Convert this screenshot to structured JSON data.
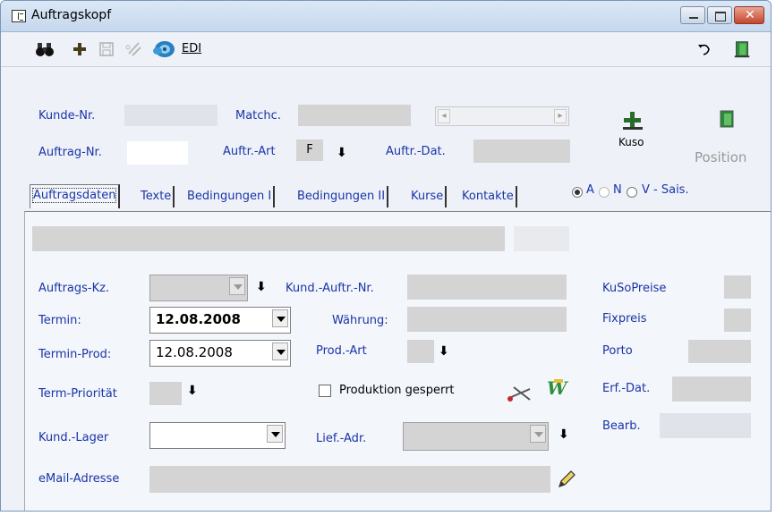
{
  "window": {
    "title": "Auftragskopf",
    "icons": [
      "window-icon",
      "minimize-icon",
      "maximize-icon",
      "close-icon"
    ]
  },
  "toolbar": {
    "edi_label": "EDI",
    "icons": [
      "binoculars-icon",
      "plus-icon",
      "save-icon",
      "cut-icon",
      "disc-icon",
      "undo-icon",
      "exit-door-icon"
    ]
  },
  "header": {
    "kunde_nr_label": "Kunde-Nr.",
    "matchc_label": "Matchc.",
    "auftrag_nr_label": "Auftrag-Nr.",
    "auftr_art_label": "Auftr.-Art",
    "auftr_art_value": "F",
    "auftr_dat_label": "Auftr.-Dat.",
    "kuso_label": "Kuso",
    "position_label": "Position",
    "radio_a": "A",
    "radio_n": "N",
    "radio_v": "V - Sais.",
    "selected_radio": "A"
  },
  "tabs": [
    "Auftragsdaten",
    "Texte",
    "Bedingungen I",
    "Bedingungen II",
    "Kurse",
    "Kontakte"
  ],
  "active_tab": "Auftragsdaten",
  "form": {
    "auftrags_kz_label": "Auftrags-Kz.",
    "termin_label": "Termin:",
    "termin_value": "12.08.2008",
    "termin_prod_label": "Termin-Prod:",
    "termin_prod_value": "12.08.2008",
    "term_prioritaet_label": "Term-Priorität",
    "kund_lager_label": "Kund.-Lager",
    "email_label": "eMail-Adresse",
    "kund_auftr_nr_label": "Kund.-Auftr.-Nr.",
    "waehrung_label": "Währung:",
    "prod_art_label": "Prod.-Art",
    "produktion_gesperrt_label": "Produktion gesperrt",
    "lief_adr_label": "Lief.-Adr.",
    "kusopreise_label": "KuSoPreise",
    "fixpreis_label": "Fixpreis",
    "porto_label": "Porto",
    "erf_dat_label": "Erf.-Dat.",
    "bearb_label": "Bearb."
  },
  "colors": {
    "label_blue": "#1a34a8",
    "field_gray": "#d4d4d4",
    "close_red": "#c6452c"
  }
}
